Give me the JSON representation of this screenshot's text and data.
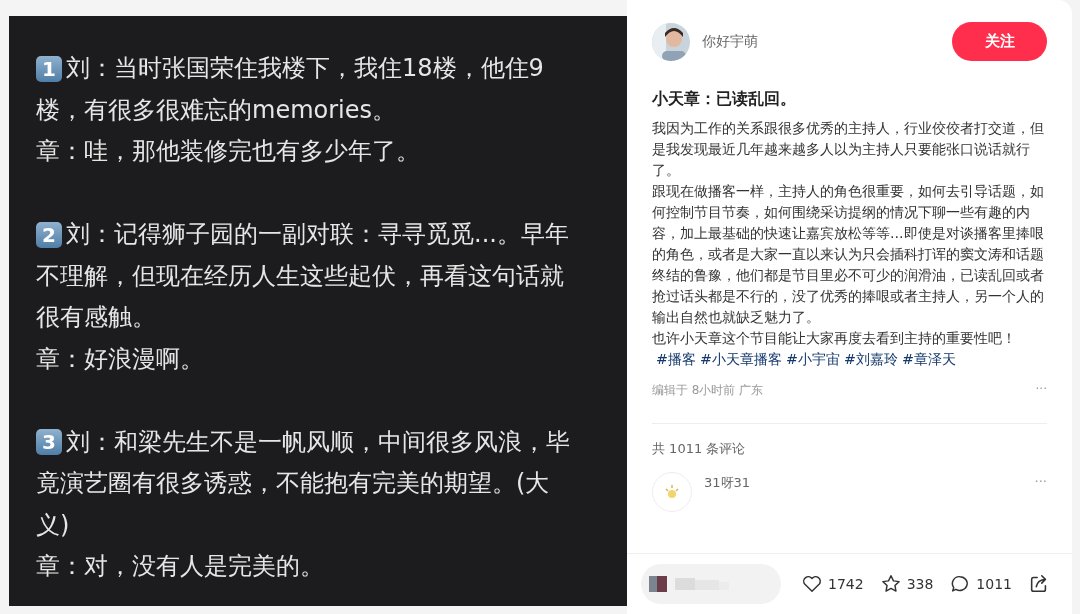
{
  "image_note": {
    "blocks": [
      {
        "badge": "1",
        "lines": [
          "刘：当时张国荣住我楼下，我住18楼，他住9",
          "楼，有很多很难忘的memories。",
          "章：哇，那他装修完也有多少年了。"
        ]
      },
      {
        "badge": "2",
        "lines": [
          "刘：记得狮子园的一副对联：寻寻觅觅...。早年",
          "不理解，但现在经历人生这些起伏，再看这句话就",
          "很有感触。",
          "章：好浪漫啊。"
        ]
      },
      {
        "badge": "3",
        "lines": [
          "刘：和梁先生不是一帆风顺，中间很多风浪，毕",
          "竟演艺圈有很多诱惑，不能抱有完美的期望。(大",
          "义)",
          "章：对，没有人是完美的。"
        ]
      }
    ]
  },
  "author": {
    "name": "你好宇萌",
    "follow_button": "关注"
  },
  "post": {
    "title": "小天章：已读乱回。",
    "paragraphs": [
      "我因为工作的关系跟很多优秀的主持人，行业佼佼者打交道，但是我发现最近几年越来越多人以为主持人只要能张口说话就行了。",
      "跟现在做播客一样，主持人的角色很重要，如何去引导话题，如何控制节目节奏，如何围绕采访提纲的情况下聊一些有趣的内容，加上最基础的快速让嘉宾放松等等...即使是对谈播客里捧哏的角色，或者是大家一直以来认为只会插科打诨的窦文涛和话题终结的鲁豫，他们都是节目里必不可少的润滑油，已读乱回或者抢过话头都是不行的，没了优秀的捧哏或者主持人，另一个人的输出自然也就缺乏魅力了。",
      "也许小天章这个节目能让大家再度去看到主持的重要性吧！"
    ],
    "tags": [
      "#播客",
      "#小天章播客",
      "#小宇宙",
      "#刘嘉玲",
      "#章泽天"
    ],
    "meta": "编辑于 8小时前 广东",
    "more": "···"
  },
  "comments": {
    "count": "共 1011 条评论",
    "items": [
      {
        "name": "31呀31",
        "more": "···"
      }
    ]
  },
  "actions": {
    "likes": "1742",
    "stars": "338",
    "comments": "1011"
  }
}
